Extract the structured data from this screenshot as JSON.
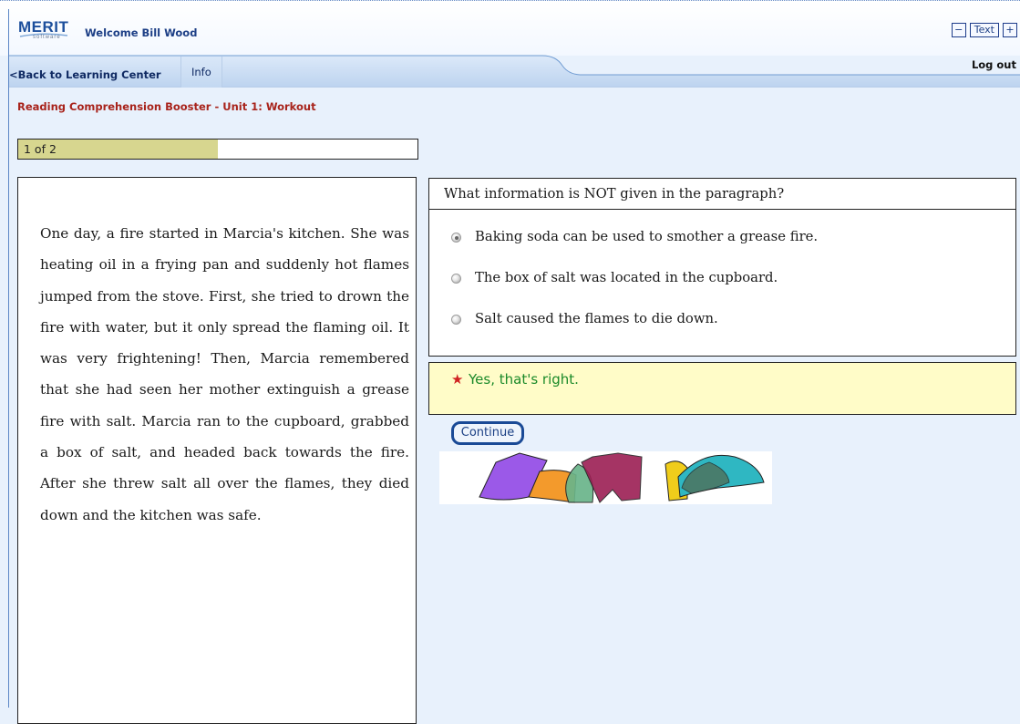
{
  "header": {
    "logo_text": "MERIT",
    "logo_subtext": "software",
    "welcome": "Welcome Bill Wood",
    "text_size": {
      "decrease_label": "−",
      "label": "Text",
      "increase_label": "+"
    }
  },
  "nav": {
    "back_label": "<Back to Learning Center",
    "info_label": "Info",
    "logout_label": "Log out"
  },
  "unit_title": "Reading Comprehension Booster - Unit 1: Workout",
  "progress": {
    "label": "1 of 2",
    "fraction": 0.5
  },
  "passage": {
    "text": "One day, a fire started in Marcia's kitchen. She was heating oil in a frying pan and suddenly hot flames jumped from the stove. First, she tried to drown the fire with water, but it only spread the flaming oil. It was very frightening! Then, Marcia remembered that she had seen her mother extinguish a grease fire with salt. Marcia ran to the cupboard, grabbed a box of salt, and headed back towards the fire. After she threw salt all over the flames, they died down and the kitchen was safe."
  },
  "question": {
    "prompt": "What information is NOT given in the paragraph?",
    "options": [
      {
        "label": "Baking soda can be used to smother a grease fire.",
        "selected": true
      },
      {
        "label": "The box of salt was located in the cupboard.",
        "selected": false
      },
      {
        "label": "Salt caused the flames to die down.",
        "selected": false
      }
    ]
  },
  "feedback": {
    "text": "Yes, that's right."
  },
  "continue_label": "Continue",
  "colors": {
    "title_red": "#a8231b",
    "feedback_green": "#1b8a2a",
    "feedback_bg": "#fffcc8",
    "progress_fill": "#d7d68f",
    "nav_blue": "#c3d8f1"
  }
}
